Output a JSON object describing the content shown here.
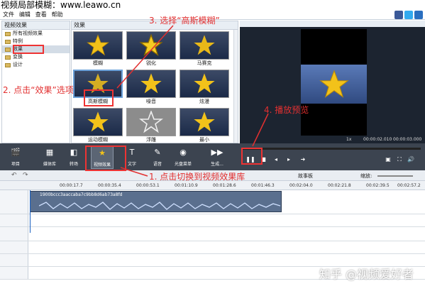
{
  "window": {
    "title": "视频局部模糊：www.leawo.cn"
  },
  "menu": {
    "items": [
      "文件",
      "编辑",
      "查看",
      "帮助"
    ]
  },
  "tree": {
    "header": "视频效果",
    "items": [
      {
        "label": "所有视频效果",
        "selected": false
      },
      {
        "label": "特例",
        "selected": false
      },
      {
        "label": "效果",
        "selected": true
      },
      {
        "label": "变换",
        "selected": false
      },
      {
        "label": "设计",
        "selected": false
      }
    ]
  },
  "effects": {
    "header": "效果",
    "items": [
      "模糊",
      "锐化",
      "马赛克",
      "高斯模糊",
      "噪音",
      "炫漫",
      "运动模糊",
      "浮雕",
      "最小"
    ]
  },
  "preview": {
    "time_current": "00:00:02.010",
    "time_total": "00:00:03.000",
    "speed": "1x"
  },
  "toolbar": {
    "items": [
      {
        "label": "项目",
        "icon": "clapper-icon",
        "selected": false
      },
      {
        "label": "媒体库",
        "icon": "media-library-icon",
        "selected": false
      },
      {
        "label": "转场",
        "icon": "transition-icon",
        "selected": false
      },
      {
        "label": "视频效果",
        "icon": "star-effect-icon",
        "selected": true
      },
      {
        "label": "文字",
        "icon": "text-icon",
        "selected": false
      },
      {
        "label": "语音",
        "icon": "voice-icon",
        "selected": false
      },
      {
        "label": "光盘菜单",
        "icon": "disc-menu-icon",
        "selected": false
      },
      {
        "label": "生成...",
        "icon": "generate-icon",
        "selected": false
      }
    ]
  },
  "timeline_bar": {
    "story_label": "故事板",
    "zoom_label": "缩放:"
  },
  "ruler": {
    "ticks": [
      "00:00:17.7",
      "00:00:35.4",
      "00:00:53.1",
      "00:01:10.9",
      "00:01:28.6",
      "00:01:46.3",
      "00:02:04.0",
      "00:02:21.8",
      "00:02:39.5",
      "00:02:57.2"
    ]
  },
  "clip": {
    "name": "1900bccc3aaccaba7c9bb8d6ab73a8fd"
  },
  "annotations": {
    "step1": "1. 点击切换到视频效果库",
    "step2": "2. 点击“效果”选项",
    "step3": "3. 选择“高斯模糊”",
    "step4": "4. 播放预览"
  },
  "watermark": "知乎 @视频爱好者",
  "colors": {
    "annotation": "#e23030",
    "toolbar_bg": "#3c4450",
    "accent": "#1a60c0"
  }
}
